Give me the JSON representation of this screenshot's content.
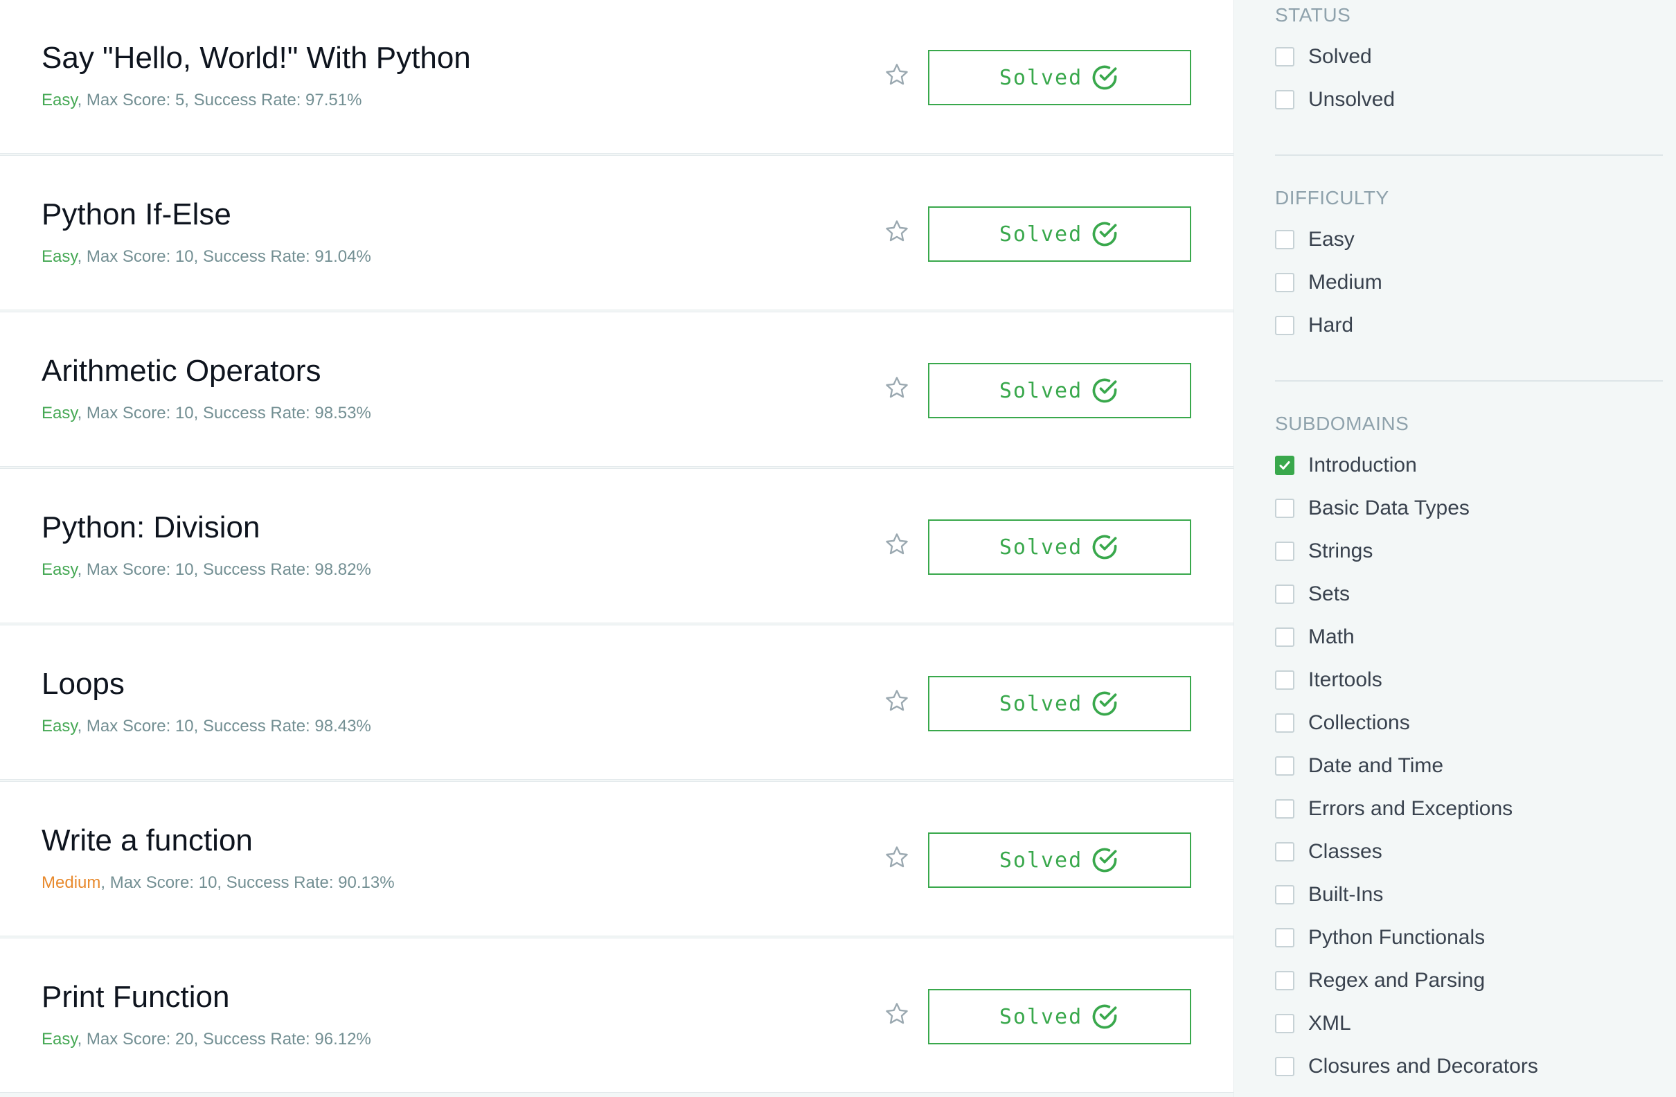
{
  "challenges": [
    {
      "title": "Say \"Hello, World!\" With Python",
      "difficulty": "Easy",
      "rest": ", Max Score: 5, Success Rate: 97.51%",
      "status": "Solved"
    },
    {
      "title": "Python If-Else",
      "difficulty": "Easy",
      "rest": ", Max Score: 10, Success Rate: 91.04%",
      "status": "Solved"
    },
    {
      "title": "Arithmetic Operators",
      "difficulty": "Easy",
      "rest": ", Max Score: 10, Success Rate: 98.53%",
      "status": "Solved"
    },
    {
      "title": "Python: Division",
      "difficulty": "Easy",
      "rest": ", Max Score: 10, Success Rate: 98.82%",
      "status": "Solved"
    },
    {
      "title": "Loops",
      "difficulty": "Easy",
      "rest": ", Max Score: 10, Success Rate: 98.43%",
      "status": "Solved"
    },
    {
      "title": "Write a function",
      "difficulty": "Medium",
      "rest": ", Max Score: 10, Success Rate: 90.13%",
      "status": "Solved"
    },
    {
      "title": "Print Function",
      "difficulty": "Easy",
      "rest": ", Max Score: 20, Success Rate: 96.12%",
      "status": "Solved"
    }
  ],
  "filters": {
    "status": {
      "title": "STATUS",
      "options": [
        {
          "label": "Solved",
          "checked": false
        },
        {
          "label": "Unsolved",
          "checked": false
        }
      ]
    },
    "difficulty": {
      "title": "DIFFICULTY",
      "options": [
        {
          "label": "Easy",
          "checked": false
        },
        {
          "label": "Medium",
          "checked": false
        },
        {
          "label": "Hard",
          "checked": false
        }
      ]
    },
    "subdomains": {
      "title": "SUBDOMAINS",
      "options": [
        {
          "label": "Introduction",
          "checked": true
        },
        {
          "label": "Basic Data Types",
          "checked": false
        },
        {
          "label": "Strings",
          "checked": false
        },
        {
          "label": "Sets",
          "checked": false
        },
        {
          "label": "Math",
          "checked": false
        },
        {
          "label": "Itertools",
          "checked": false
        },
        {
          "label": "Collections",
          "checked": false
        },
        {
          "label": "Date and Time",
          "checked": false
        },
        {
          "label": "Errors and Exceptions",
          "checked": false
        },
        {
          "label": "Classes",
          "checked": false
        },
        {
          "label": "Built-Ins",
          "checked": false
        },
        {
          "label": "Python Functionals",
          "checked": false
        },
        {
          "label": "Regex and Parsing",
          "checked": false
        },
        {
          "label": "XML",
          "checked": false
        },
        {
          "label": "Closures and Decorators",
          "checked": false
        }
      ]
    }
  },
  "icons": {
    "star": "star-outline-icon",
    "solved": "check-circle-icon",
    "checkbox_checked": "checkmark-icon"
  },
  "colors": {
    "accent_green": "#39a84c",
    "easy": "#45a854",
    "medium": "#e88a2e",
    "meta_text": "#738f93",
    "title_text": "#0e141e",
    "section_title": "#8fa2ac"
  }
}
